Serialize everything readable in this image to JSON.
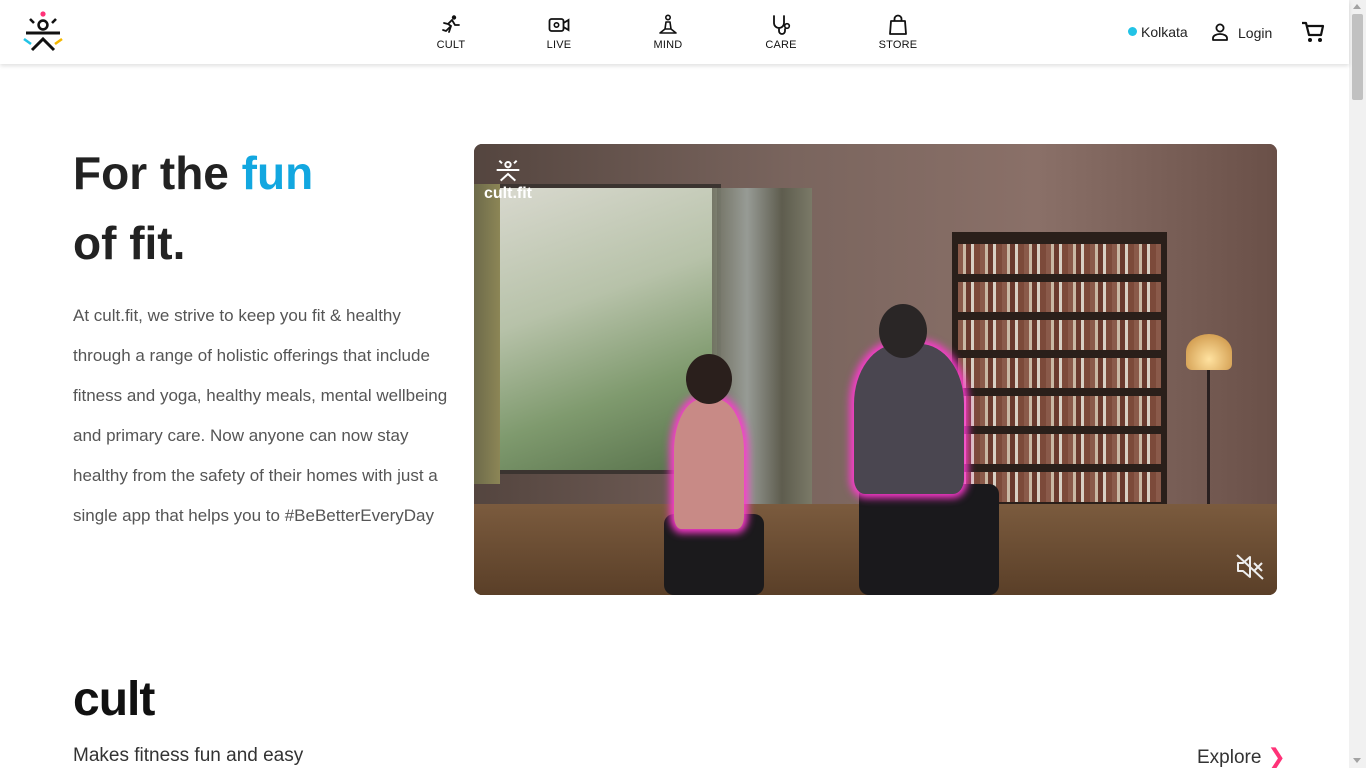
{
  "header": {
    "logo": "cult.fit-logo-icon",
    "nav": [
      {
        "label": "CULT",
        "icon": "running-person-icon"
      },
      {
        "label": "LIVE",
        "icon": "video-camera-icon"
      },
      {
        "label": "MIND",
        "icon": "meditation-icon"
      },
      {
        "label": "CARE",
        "icon": "stethoscope-icon"
      },
      {
        "label": "STORE",
        "icon": "shopping-bag-icon"
      }
    ],
    "location": "Kolkata",
    "login": "Login",
    "cart_icon": "shopping-cart-icon"
  },
  "hero": {
    "title_prefix": "For the ",
    "title_accent": "fun",
    "title_suffix": "of fit.",
    "description": "At cult.fit, we strive to keep you fit & healthy through a range of holistic offerings that include fitness and yoga, healthy meals, mental wellbeing and primary care. Now anyone can now stay healthy from the safety of their homes with just a single app that helps you to #BeBetterEveryDay",
    "video_logo_text": "cult.fit",
    "mute_icon": "speaker-muted-icon"
  },
  "cult_section": {
    "title": "cult",
    "subtitle": "Makes fitness fun and easy",
    "explore": "Explore"
  },
  "colors": {
    "accent": "#12a7e0",
    "explore_chevron": "#ff3278",
    "location_dot": "#22c3e6"
  }
}
